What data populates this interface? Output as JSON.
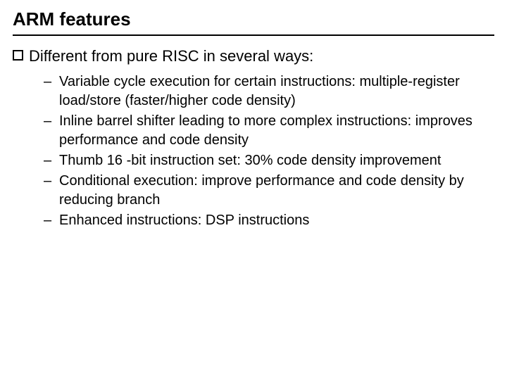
{
  "title": "ARM features",
  "lead": "Different from pure RISC in several ways:",
  "items": [
    "Variable cycle execution for certain instructions: multiple-register load/store (faster/higher code density)",
    "Inline barrel shifter leading to more complex instructions: improves performance and code density",
    "Thumb 16 -bit instruction set: 30% code density improvement",
    "Conditional execution: improve performance and code density by reducing branch",
    "Enhanced instructions: DSP instructions"
  ]
}
